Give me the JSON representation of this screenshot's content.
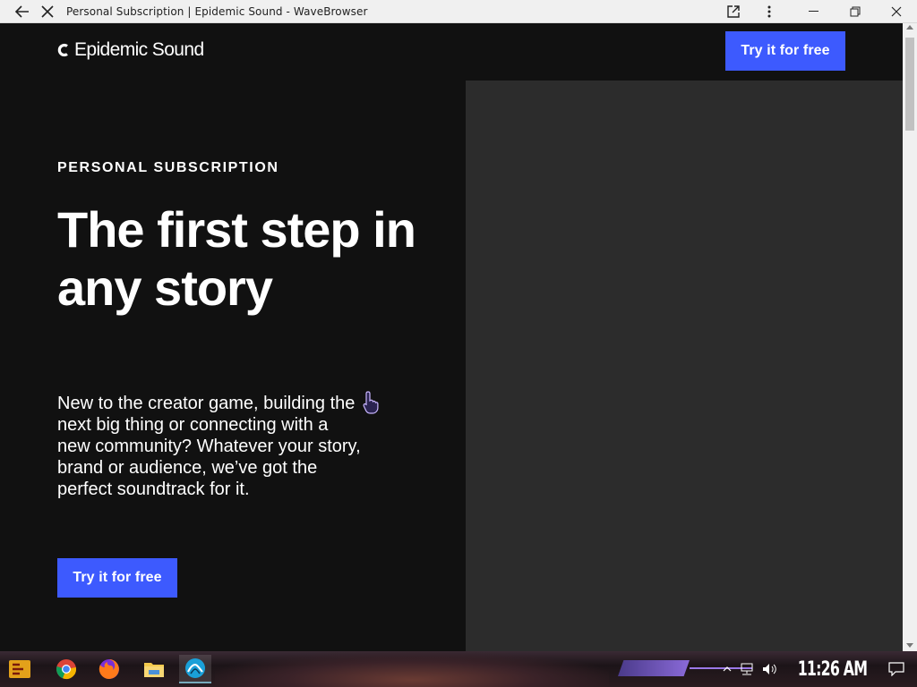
{
  "browser": {
    "title": "Personal Subscription | Epidemic Sound - WaveBrowser"
  },
  "header": {
    "logo_text": "Epidemic Sound",
    "cta_label": "Try it for free"
  },
  "hero": {
    "eyebrow": "PERSONAL SUBSCRIPTION",
    "headline": "The first step in any story",
    "body": "New to the creator game, building the next big thing or connecting with a new community? Whatever your story, brand or audience, we’ve got the perfect soundtrack for it.",
    "cta_label": "Try it for free"
  },
  "taskbar": {
    "clock": "11:26 AM",
    "apps": [
      "start-icon",
      "chrome-icon",
      "firefox-icon",
      "file-explorer-icon",
      "wavebrowser-icon"
    ]
  },
  "colors": {
    "accent": "#3d5afe",
    "page_bg": "#111111",
    "media_bg": "#2c2c2c"
  }
}
